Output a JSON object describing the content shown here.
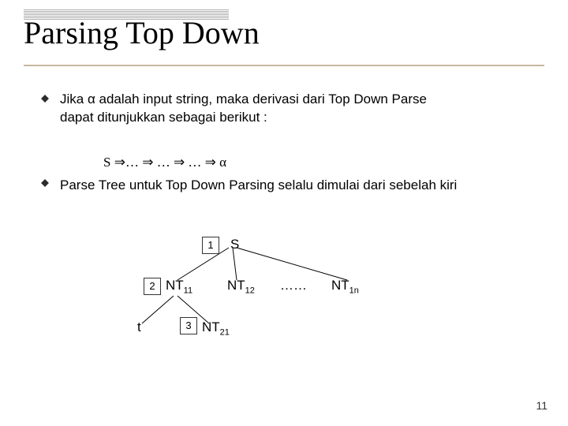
{
  "title": "Parsing Top Down",
  "bullet1": {
    "line1": "Jika α adalah input string, maka derivasi dari Top Down Parse",
    "line2": "dapat ditunjukkan sebagai berikut :"
  },
  "bullet2": {
    "deriv": "S ⇒… ⇒ … ⇒ … ⇒ α",
    "line2": "Parse Tree untuk Top Down Parsing selalu dimulai dari sebelah kiri"
  },
  "diagram": {
    "step1": "1",
    "step2": "2",
    "step3": "3",
    "root": "S",
    "nt11": "NT",
    "nt11_sub": "11",
    "nt12": "NT",
    "nt12_sub": "12",
    "dots": "……",
    "nt1n": "NT",
    "nt1n_sub": "1n",
    "t": "t",
    "nt21": "NT",
    "nt21_sub": "21"
  },
  "page_number": "11"
}
